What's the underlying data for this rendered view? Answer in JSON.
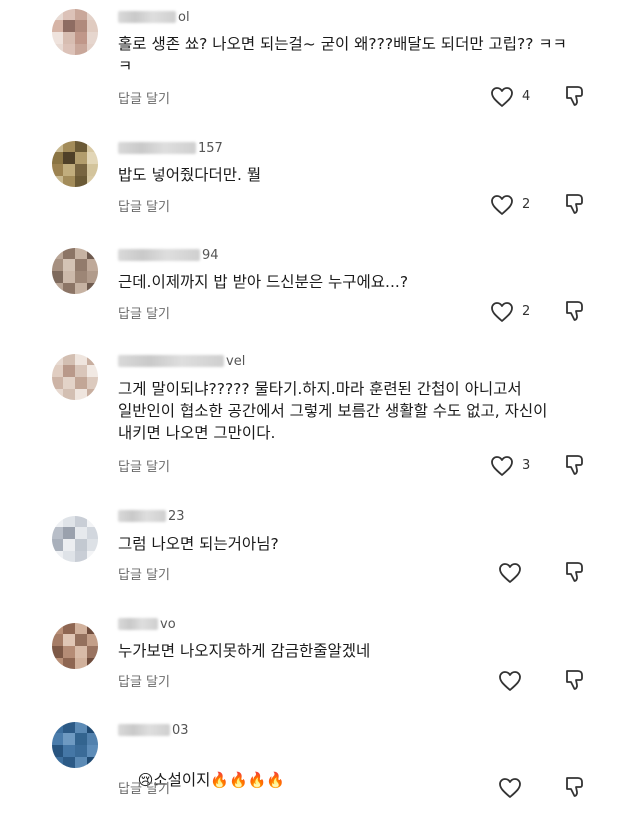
{
  "comments": [
    {
      "username_suffix": "ol",
      "text": "홀로 생존 쑈? 나오면 되는걸~ 굳이 왜???배달도 되더만 고립?? ㅋㅋ\nㅋ",
      "reply_label": "답글 달기",
      "likes": "4",
      "avatar_colors": [
        "#e8dad3",
        "#dcc2b8",
        "#c9a79a",
        "#e3d1c8",
        "#d6b4a6",
        "#8e6c62",
        "#b08a7c",
        "#e0cbc0",
        "#efe3dd",
        "#d7bdb1",
        "#c09789",
        "#e6d6ce"
      ]
    },
    {
      "username_suffix": "157",
      "text": "밥도 넣어줬다더만. 뭘",
      "reply_label": "답글 달기",
      "likes": "2",
      "avatar_colors": [
        "#c8b88f",
        "#a38c5a",
        "#6b5a36",
        "#d8c9a3",
        "#8a7443",
        "#4f4028",
        "#b29d6d",
        "#e2d6b7",
        "#9c8250",
        "#c1ad7d",
        "#786541",
        "#d3c49c"
      ]
    },
    {
      "username_suffix": "94",
      "text": "근데.이제까지 밥 받아 드신분은 누구에요...?",
      "reply_label": "답글 달기",
      "likes": "2",
      "avatar_colors": [
        "#b9a596",
        "#8c7566",
        "#c6b2a2",
        "#6f5b4f",
        "#a69080",
        "#d4c3b5",
        "#927b6c",
        "#bfa999",
        "#7e6a5d",
        "#ccb9aa",
        "#9d8676",
        "#b19b8b"
      ]
    },
    {
      "username_suffix": "vel",
      "text": "그게 말이되냐????? 물타기.하지.마라 훈련된 간첩이 아니고서\n일반인이 협소한 공간에서 그렇게 보름간 생활할 수도 없고, 자신이\n내키면 나오면 그만이다.",
      "reply_label": "답글 달기",
      "likes": "3",
      "avatar_colors": [
        "#e6d8cf",
        "#d3bfb2",
        "#efe5de",
        "#c8ae9f",
        "#e0cdc1",
        "#b9998a",
        "#d9c6ba",
        "#f1e9e3",
        "#cdb4a6",
        "#e3d3c8",
        "#c2a696",
        "#dccabe"
      ]
    },
    {
      "username_suffix": "23",
      "text": "그럼 나오면 되는거아님?",
      "reply_label": "답글 달기",
      "likes": "",
      "avatar_colors": [
        "#eef0f3",
        "#dfe3e8",
        "#c9ced6",
        "#f3f4f6",
        "#b8bec8",
        "#9aa1ad",
        "#e6e9ed",
        "#d2d7de",
        "#a9b0bb",
        "#eceef1",
        "#c3c9d1",
        "#dde1e6"
      ]
    },
    {
      "username_suffix": "vo",
      "text": "누가보면 나오지못하게 감금한줄알겠네",
      "reply_label": "답글 달기",
      "likes": "",
      "avatar_colors": [
        "#b88f77",
        "#8e6652",
        "#d1b19c",
        "#6f4c3c",
        "#a57c66",
        "#e0c6b5",
        "#94705d",
        "#c39f89",
        "#7d5846",
        "#b58c76",
        "#d8bba8",
        "#9a7461"
      ]
    },
    {
      "username_suffix": "03",
      "text": "소설이지",
      "emoji_prefix": "😢",
      "emoji_suffix": "🔥🔥🔥🔥",
      "reply_label": "답글 달기",
      "likes": "",
      "avatar_colors": [
        "#3d6f9e",
        "#2c5a86",
        "#5b8ab5",
        "#1f4a73",
        "#4a7cab",
        "#6e9ac2",
        "#33648f",
        "#5281ad",
        "#27547f",
        "#4577a6",
        "#3a6b98",
        "#5d8cb8"
      ]
    }
  ],
  "colors": {
    "text": "#1a1a1a",
    "secondary": "#6b6b6b",
    "icon": "#333333"
  }
}
